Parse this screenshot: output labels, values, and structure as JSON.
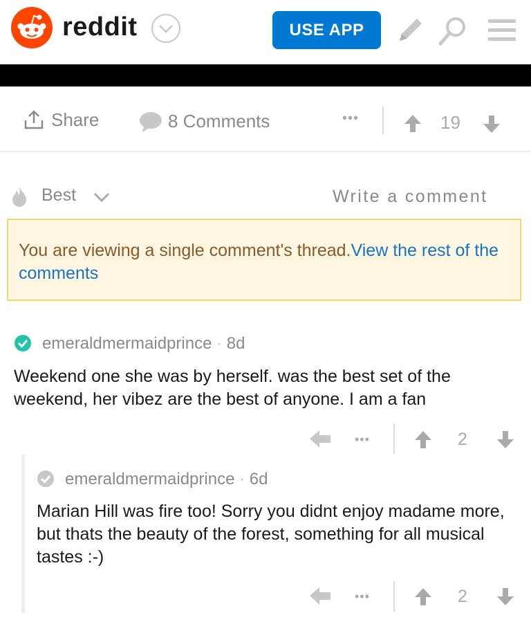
{
  "header": {
    "wordmark": "reddit",
    "use_app_label": "USE APP",
    "icons": [
      "reddit-snoo-logo",
      "chevron-down-icon",
      "pencil-icon",
      "search-icon",
      "hamburger-menu-icon"
    ],
    "brand_color": "#ff4500",
    "accent_color": "#0079d3"
  },
  "post_actions": {
    "share_label": "Share",
    "comments_label": "8 Comments",
    "more_label": "•••",
    "score": "19"
  },
  "sort": {
    "label": "Best",
    "write_comment_label": "Write a comment"
  },
  "notice": {
    "text": "You are viewing a single comment's thread.",
    "link_text": "View the rest of the comments"
  },
  "comments": [
    {
      "author": "emeraldmermaidprince",
      "separator": "·",
      "age": "8d",
      "body": "Weekend one she was by herself. was the best set of the weekend, her vibez are the best of anyone. I am a fan",
      "score": "2",
      "more_label": "•••"
    },
    {
      "author": "emeraldmermaidprince",
      "separator": "·",
      "age": "6d",
      "body": "Marian Hill was fire too! Sorry you didnt enjoy madame more, but thats the beauty of the forest, something for all musical tastes :-)",
      "score": "2",
      "more_label": "•••"
    }
  ]
}
